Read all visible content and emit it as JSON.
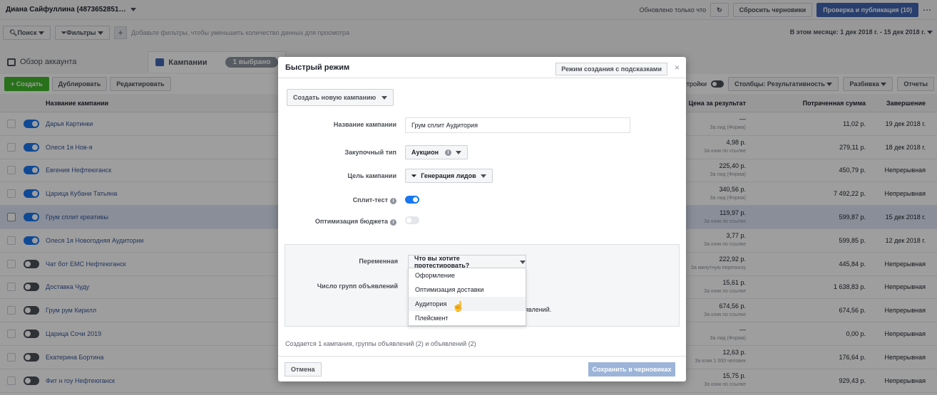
{
  "topbar": {
    "account": "Диана Сайфуллина (4873652851…",
    "updated": "Обновлено только что",
    "discard": "Сбросить черновики",
    "review": "Проверка и публикация (10)"
  },
  "filters": {
    "search": "Поиск",
    "filters": "Фильтры",
    "placeholder": "Добавьте фильтры, чтобы уменьшить количество данных для просмотра",
    "date": "В этом месяце: 1 дек 2018 г. - 15 дек 2018 г."
  },
  "tabs": {
    "overview": "Обзор аккаунта",
    "campaigns": "Кампании",
    "selected": "1 выбрано"
  },
  "toolbar": {
    "create": "Создать",
    "duplicate": "Дублировать",
    "edit": "Редактировать",
    "settings": "астройки",
    "columns": "Столбцы: Результативность",
    "breakdown": "Разбивка",
    "reports": "Отчеты"
  },
  "table": {
    "h_name": "Название кампании",
    "h_cost": "Цена за результат",
    "h_spent": "Потраченная сумма",
    "h_end": "Завершение",
    "rows": [
      {
        "name": "Дарья Картинки",
        "cost": "—",
        "cost_sub": "За лид (Форма)",
        "spent": "11,02 р.",
        "end": "19 дек 2018 г."
      },
      {
        "name": "Олеся 1я Нов-я",
        "cost": "4,98 р.",
        "cost_sub": "За клик по ссылке",
        "spent": "279,11 р.",
        "end": "18 дек 2018 г."
      },
      {
        "name": "Евгения Нефтеюганск",
        "cost": "225,40 р.",
        "cost_sub": "За лид (Форма)",
        "spent": "450,79 р.",
        "end": "Непрерывная"
      },
      {
        "name": "Царица Кубани Татьяна",
        "cost": "340,56 р.",
        "cost_sub": "За лид (Форма)",
        "spent": "7 492,22 р.",
        "end": "Непрерывная"
      },
      {
        "name": "Грум сплит креативы",
        "cost": "119,97 р.",
        "cost_sub": "За клик по ссылке",
        "spent": "599,87 р.",
        "end": "15 дек 2018 г."
      },
      {
        "name": "Олеся 1я Новогодняя Аудитории",
        "cost": "3,77 р.",
        "cost_sub": "За клик по ссылке",
        "spent": "599,85 р.",
        "end": "12 дек 2018 г."
      },
      {
        "name": "Чат бот ЕМС Нефтеюганск",
        "cost": "222,92 р.",
        "cost_sub": "За минутную переписку",
        "spent": "445,84 р.",
        "end": "Непрерывная"
      },
      {
        "name": "Доставка Чуду",
        "cost": "15,61 р.",
        "cost_sub": "За клик по ссылке",
        "spent": "1 638,83 р.",
        "end": "Непрерывная"
      },
      {
        "name": "Грум рум Кирилл",
        "cost": "674,56 р.",
        "cost_sub": "За клик по ссылке",
        "spent": "674,56 р.",
        "end": "Непрерывная"
      },
      {
        "name": "Царица Сочи 2019",
        "cost": "—",
        "cost_sub": "За лид (Форма)",
        "spent": "0,00 р.",
        "end": "Непрерывная"
      },
      {
        "name": "Екатерина Бортина",
        "cost": "12,63 р.",
        "cost_sub": "За клик 1 000 человек",
        "spent": "176,64 р.",
        "end": "Непрерывная"
      },
      {
        "name": "Фит н гоу Нефтеюганск",
        "cost": "15,75 р.",
        "cost_sub": "За клик по ссылке",
        "spent": "929,43 р.",
        "end": "Непрерывная"
      }
    ]
  },
  "modal": {
    "title": "Быстрый режим",
    "guided": "Режим создания с подсказками",
    "close": "×",
    "new_campaign": "Создать новую кампанию",
    "name_label": "Название кампании",
    "name_value": "Грум сплит Аудитория",
    "buying_label": "Закупочный тип",
    "buying_value": "Аукцион",
    "objective_label": "Цель кампании",
    "objective_value": "Генерация лидов",
    "split_label": "Сплит-тест",
    "budget_label": "Оптимизация бюджета",
    "variable_label": "Переменная",
    "variable_placeholder": "Что вы хотите протестировать?",
    "adsets_label": "Число групп объявлений",
    "options": [
      "Оформление",
      "Оптимизация доставки",
      "Аудитория",
      "Плейсмент"
    ],
    "behind_text": "явлений.",
    "summary": "Создается 1 кампания, группы объявлений (2) и объявлений (2)",
    "cancel": "Отмена",
    "save": "Сохранить в черновиках"
  }
}
